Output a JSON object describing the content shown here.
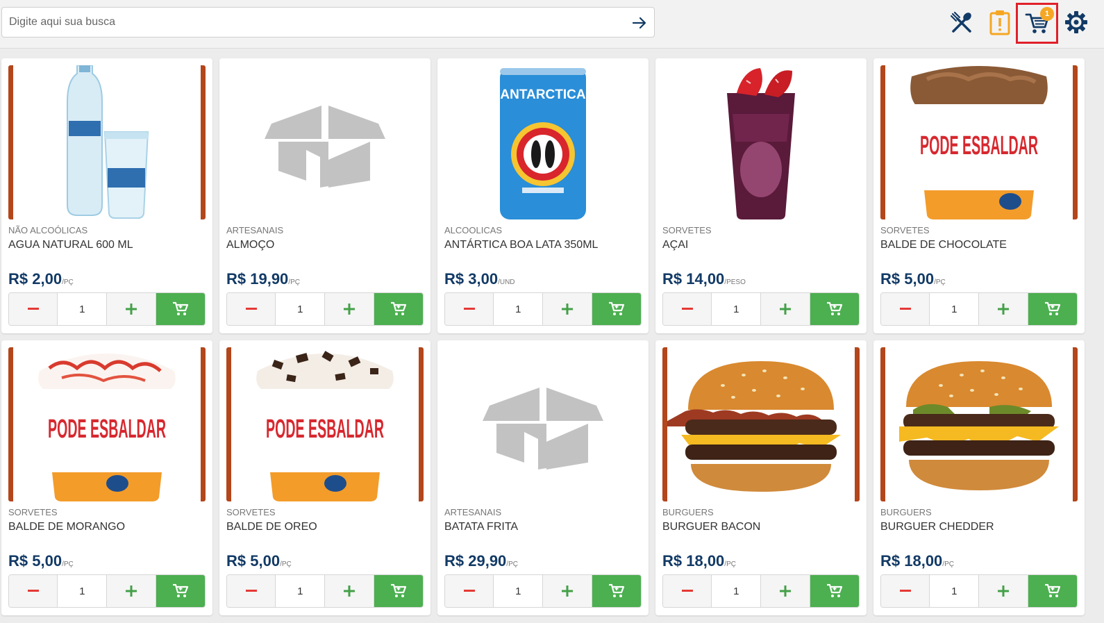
{
  "search": {
    "placeholder": "Digite aqui sua busca"
  },
  "header_icons": [
    {
      "name": "menu-cutlery-icon",
      "color": "#123a66"
    },
    {
      "name": "orders-clipboard-icon",
      "color": "#f5a623"
    },
    {
      "name": "cart-icon",
      "color": "#123a66",
      "badge": "1",
      "highlight": "#e0202a"
    },
    {
      "name": "settings-gear-icon",
      "color": "#123a66"
    }
  ],
  "colors": {
    "price": "#123a66",
    "add_button": "#4caf50",
    "minus": "#e53935",
    "plus": "#43a047",
    "frame": "#b3461b"
  },
  "products": [
    {
      "category": "NÃO ALCOÓLICAS",
      "name": "AGUA NATURAL 600 ML",
      "price": "R$ 2,00",
      "unit": "/PÇ",
      "qty": "1",
      "image": "water-bottle",
      "has_photo": true
    },
    {
      "category": "ARTESANAIS",
      "name": "ALMOÇO",
      "price": "R$ 19,90",
      "unit": "/PÇ",
      "qty": "1",
      "image": "placeholder-box",
      "has_photo": false
    },
    {
      "category": "ALCOOLICAS",
      "name": "ANTÁRTICA BOA LATA 350ML",
      "price": "R$ 3,00",
      "unit": "/UND",
      "qty": "1",
      "image": "beer-can",
      "has_photo": false,
      "image_text": "ANTARCTICA"
    },
    {
      "category": "SORVETES",
      "name": "AÇAI",
      "price": "R$ 14,00",
      "unit": "/PESO",
      "qty": "1",
      "image": "acai-cup",
      "has_photo": false
    },
    {
      "category": "SORVETES",
      "name": "BALDE DE CHOCOLATE",
      "price": "R$ 5,00",
      "unit": "/PÇ",
      "qty": "1",
      "image": "ice-cream-bucket-chocolate",
      "has_photo": true,
      "image_text": "PODE ESBALDAR"
    },
    {
      "category": "SORVETES",
      "name": "BALDE DE MORANGO",
      "price": "R$ 5,00",
      "unit": "/PÇ",
      "qty": "1",
      "image": "ice-cream-bucket-strawberry",
      "has_photo": true,
      "image_text": "PODE ESBALDAR"
    },
    {
      "category": "SORVETES",
      "name": "BALDE DE OREO",
      "price": "R$ 5,00",
      "unit": "/PÇ",
      "qty": "1",
      "image": "ice-cream-bucket-oreo",
      "has_photo": true,
      "image_text": "PODE ESBALDAR"
    },
    {
      "category": "ARTESANAIS",
      "name": "BATATA FRITA",
      "price": "R$ 29,90",
      "unit": "/PÇ",
      "qty": "1",
      "image": "placeholder-box",
      "has_photo": false
    },
    {
      "category": "BURGUERS",
      "name": "BURGUER BACON",
      "price": "R$ 18,00",
      "unit": "/PÇ",
      "qty": "1",
      "image": "burger-bacon",
      "has_photo": true
    },
    {
      "category": "BURGUERS",
      "name": "BURGUER CHEDDER",
      "price": "R$ 18,00",
      "unit": "/PÇ",
      "qty": "1",
      "image": "burger-cheddar",
      "has_photo": true
    }
  ]
}
